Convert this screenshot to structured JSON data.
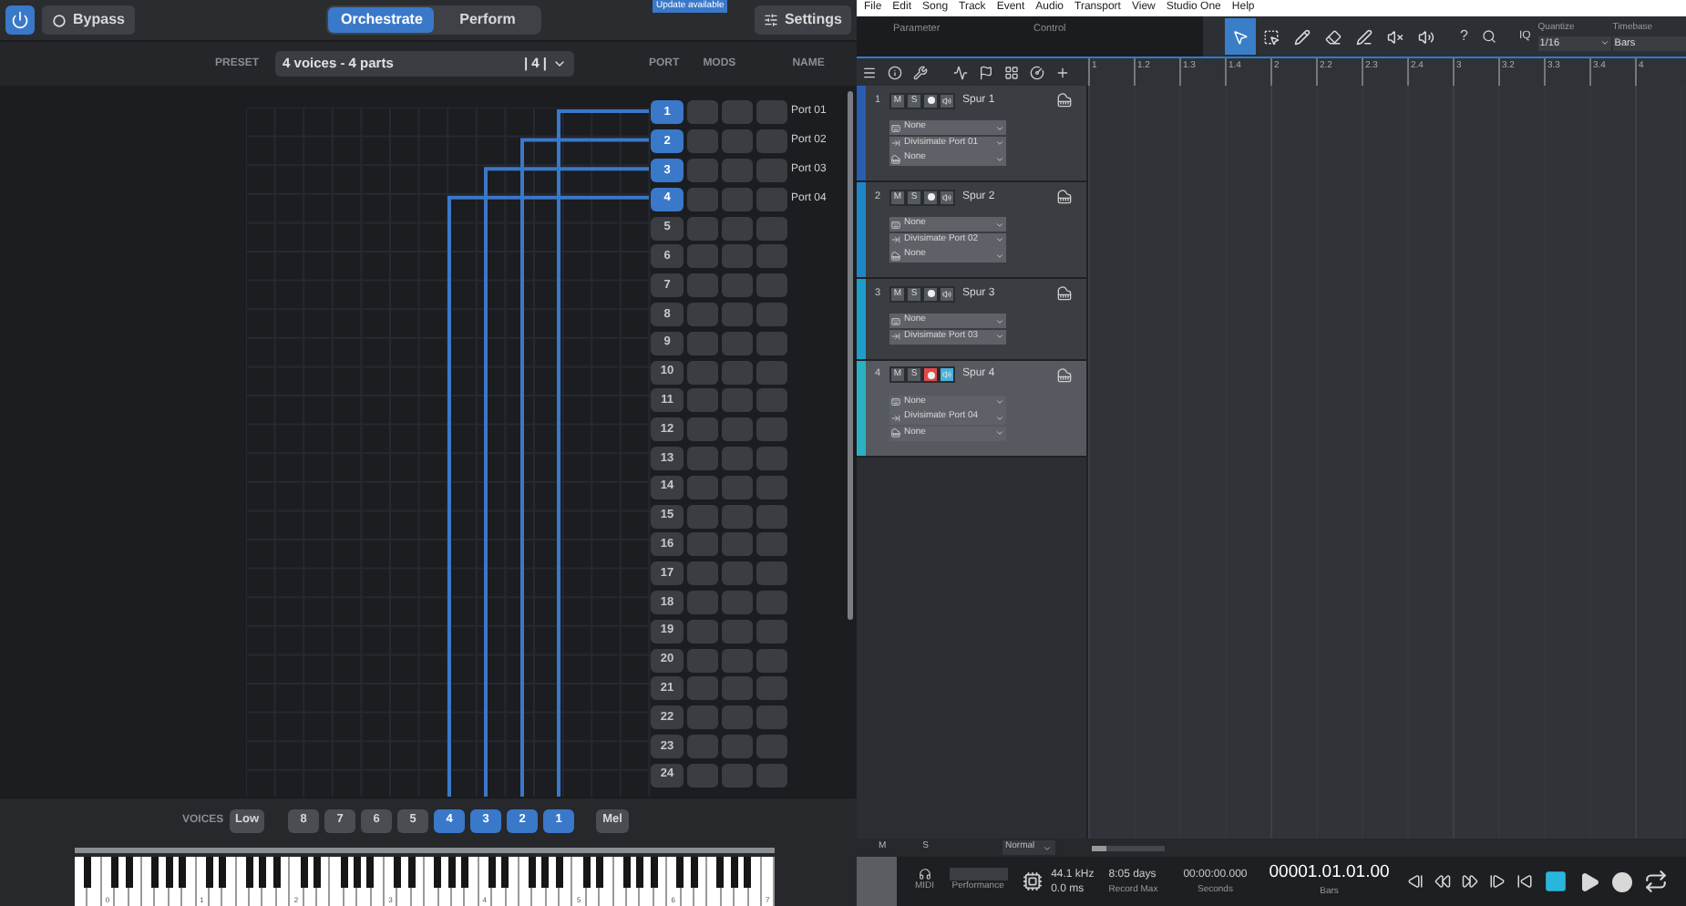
{
  "plugin": {
    "power": {
      "on": true
    },
    "bypass": "Bypass",
    "modes": [
      {
        "label": "Orchestrate",
        "selected": true
      },
      {
        "label": "Perform",
        "selected": false
      }
    ],
    "update_badge": "Update available",
    "settings": "Settings",
    "preset_label": "PRESET",
    "preset": "4 voices - 4 parts",
    "preset_count": "| 4 |",
    "columns": [
      "PORT",
      "MODS",
      "NAME"
    ],
    "ports": [
      {
        "number": "1",
        "selected": true,
        "name": "Port 01"
      },
      {
        "number": "2",
        "selected": true,
        "name": "Port 02"
      },
      {
        "number": "3",
        "selected": true,
        "name": "Port 03"
      },
      {
        "number": "4",
        "selected": true,
        "name": "Port 04"
      },
      {
        "number": "5",
        "selected": false
      },
      {
        "number": "6",
        "selected": false
      },
      {
        "number": "7",
        "selected": false
      },
      {
        "number": "8",
        "selected": false
      },
      {
        "number": "9",
        "selected": false
      },
      {
        "number": "10",
        "selected": false
      },
      {
        "number": "11",
        "selected": false
      },
      {
        "number": "12",
        "selected": false
      },
      {
        "number": "13",
        "selected": false
      },
      {
        "number": "14",
        "selected": false
      },
      {
        "number": "15",
        "selected": false
      },
      {
        "number": "16",
        "selected": false
      },
      {
        "number": "17",
        "selected": false
      },
      {
        "number": "18",
        "selected": false
      },
      {
        "number": "19",
        "selected": false
      },
      {
        "number": "20",
        "selected": false
      },
      {
        "number": "21",
        "selected": false
      },
      {
        "number": "22",
        "selected": false
      },
      {
        "number": "23",
        "selected": false
      },
      {
        "number": "24",
        "selected": false
      }
    ],
    "voices_label": "VOICES",
    "voice_low": "Low",
    "voice_mel": "Mel",
    "voices": [
      {
        "label": "8",
        "selected": false
      },
      {
        "label": "7",
        "selected": false
      },
      {
        "label": "6",
        "selected": false
      },
      {
        "label": "5",
        "selected": false
      },
      {
        "label": "4",
        "selected": true
      },
      {
        "label": "3",
        "selected": true
      },
      {
        "label": "2",
        "selected": true
      },
      {
        "label": "1",
        "selected": true
      }
    ],
    "octaves": [
      "0",
      "1",
      "2",
      "3",
      "4",
      "5",
      "6",
      "7"
    ]
  },
  "daw": {
    "menu": [
      "File",
      "Edit",
      "Song",
      "Track",
      "Event",
      "Audio",
      "Transport",
      "View",
      "Studio One",
      "Help"
    ],
    "parameter": "Parameter",
    "control": "Control",
    "tools": [
      {
        "kind": "arrow",
        "selected": true
      },
      {
        "kind": "range",
        "selected": false
      },
      {
        "kind": "pencil",
        "selected": false
      },
      {
        "kind": "eraser",
        "selected": false
      },
      {
        "kind": "line",
        "selected": false
      },
      {
        "kind": "mute",
        "selected": false
      },
      {
        "kind": "listen",
        "selected": false
      }
    ],
    "help": "?",
    "iq": "IQ",
    "quantize_label": "Quantize",
    "quantize": "1/16",
    "timebase_label": "Timebase",
    "timebase": "Bars",
    "ruler": [
      "1",
      "1.2",
      "1.3",
      "1.4",
      "2",
      "2.2",
      "2.3",
      "2.4",
      "3",
      "3.2",
      "3.3",
      "3.4",
      "4"
    ],
    "tracks": [
      {
        "number": "1",
        "name": "Spur 1",
        "color": "#2a5cb0",
        "selected": false,
        "mute": "M",
        "solo": "S",
        "record": false,
        "monitor": false,
        "routes": [
          {
            "kind": "input",
            "label": "None"
          },
          {
            "kind": "output",
            "label": "Divisimate Port 01"
          },
          {
            "kind": "instrument",
            "label": "None"
          }
        ]
      },
      {
        "number": "2",
        "name": "Spur 2",
        "color": "#1f86c8",
        "selected": false,
        "mute": "M",
        "solo": "S",
        "record": false,
        "monitor": false,
        "routes": [
          {
            "kind": "input",
            "label": "None"
          },
          {
            "kind": "output",
            "label": "Divisimate Port 02"
          },
          {
            "kind": "instrument",
            "label": "None"
          }
        ]
      },
      {
        "number": "3",
        "name": "Spur 3",
        "color": "#1e9ec8",
        "selected": false,
        "mute": "M",
        "solo": "S",
        "record": false,
        "monitor": false,
        "routes": [
          {
            "kind": "input",
            "label": "None"
          },
          {
            "kind": "output",
            "label": "Divisimate Port 03"
          }
        ]
      },
      {
        "number": "4",
        "name": "Spur 4",
        "color": "#2ab2c4",
        "selected": true,
        "mute": "M",
        "solo": "S",
        "record": true,
        "monitor": true,
        "routes": [
          {
            "kind": "input",
            "label": "None"
          },
          {
            "kind": "output",
            "label": "Divisimate Port 04"
          },
          {
            "kind": "instrument",
            "label": "None"
          }
        ]
      }
    ],
    "footer": {
      "mute": "M",
      "solo": "S",
      "mode": "Normal",
      "zoom": {
        "level": 0.2
      }
    },
    "transport": {
      "midi": "MIDI",
      "performance": "Performance",
      "sample_rate": "44.1 kHz",
      "latency": "0.0 ms",
      "record_max": "8:05 days",
      "record_max_label": "Record Max",
      "seconds": "00:00:00.000",
      "seconds_label": "Seconds",
      "bars": "00001.01.01.00",
      "bars_label": "Bars",
      "buttons": [
        {
          "kind": "back",
          "active": false
        },
        {
          "kind": "rewind",
          "active": false
        },
        {
          "kind": "forward",
          "active": false
        },
        {
          "kind": "end",
          "active": false
        },
        {
          "kind": "start",
          "active": false
        },
        {
          "kind": "stop",
          "active": true
        },
        {
          "kind": "play",
          "active": false
        },
        {
          "kind": "record",
          "active": false
        },
        {
          "kind": "loop",
          "active": false
        }
      ]
    }
  }
}
